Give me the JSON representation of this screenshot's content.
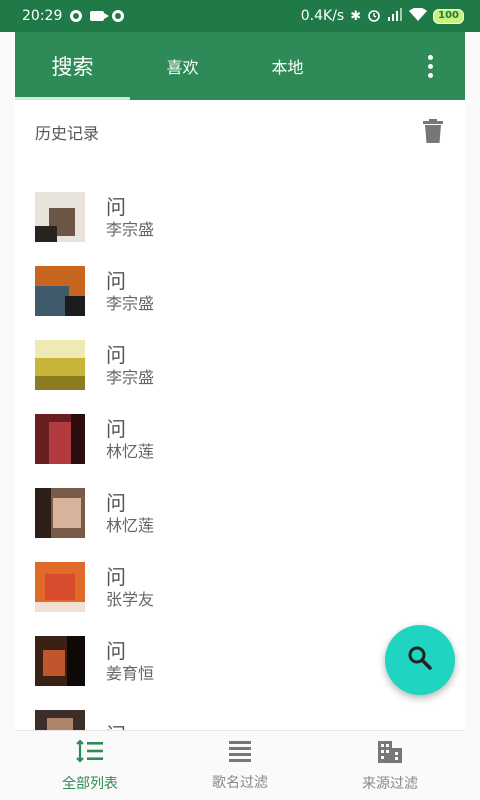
{
  "status_bar": {
    "time": "20:29",
    "network_speed": "0.4K/s",
    "battery": "100",
    "icons": [
      "notification-dot-icon",
      "video-camera-icon",
      "notification-dot-icon",
      "bluetooth-icon",
      "alarm-icon",
      "signal-icon",
      "wifi-icon",
      "battery-icon"
    ]
  },
  "tabs": [
    {
      "label": "搜索",
      "active": true
    },
    {
      "label": "喜欢",
      "active": false
    },
    {
      "label": "本地",
      "active": false
    }
  ],
  "history": {
    "title": "历史记录",
    "items": [
      {
        "song": "问",
        "artist": "李宗盛",
        "cover_colors": [
          "#e9e4db",
          "#6b5646",
          "#2a241f"
        ]
      },
      {
        "song": "问",
        "artist": "李宗盛",
        "cover_colors": [
          "#c8651e",
          "#3f5a6a",
          "#1a1c20"
        ]
      },
      {
        "song": "问",
        "artist": "李宗盛",
        "cover_colors": [
          "#efe9b4",
          "#c9b43a",
          "#8d7b22"
        ]
      },
      {
        "song": "问",
        "artist": "林忆莲",
        "cover_colors": [
          "#6a1e22",
          "#b23b3e",
          "#2b0d10"
        ]
      },
      {
        "song": "问",
        "artist": "林忆莲",
        "cover_colors": [
          "#7a5a48",
          "#d8b39b",
          "#2d1f18"
        ]
      },
      {
        "song": "问",
        "artist": "张学友",
        "cover_colors": [
          "#e06a2a",
          "#d94b2f",
          "#f2e0d3"
        ]
      },
      {
        "song": "问",
        "artist": "姜育恒",
        "cover_colors": [
          "#3a2116",
          "#c2552c",
          "#0f0907"
        ]
      },
      {
        "song": "问",
        "artist": "",
        "cover_colors": [
          "#3c2f2a",
          "#b0846a",
          "#16110f"
        ]
      }
    ]
  },
  "bottom_nav": [
    {
      "label": "全部列表",
      "icon": "sort-list-icon",
      "active": true
    },
    {
      "label": "歌名过滤",
      "icon": "menu-list-icon",
      "active": false
    },
    {
      "label": "来源过滤",
      "icon": "building-icon",
      "active": false
    }
  ],
  "colors": {
    "status_bar": "#1f7a48",
    "app_bar": "#2e8b57",
    "fab": "#1fd4c0",
    "active_nav": "#2e8b57",
    "inactive_nav": "#888888"
  }
}
